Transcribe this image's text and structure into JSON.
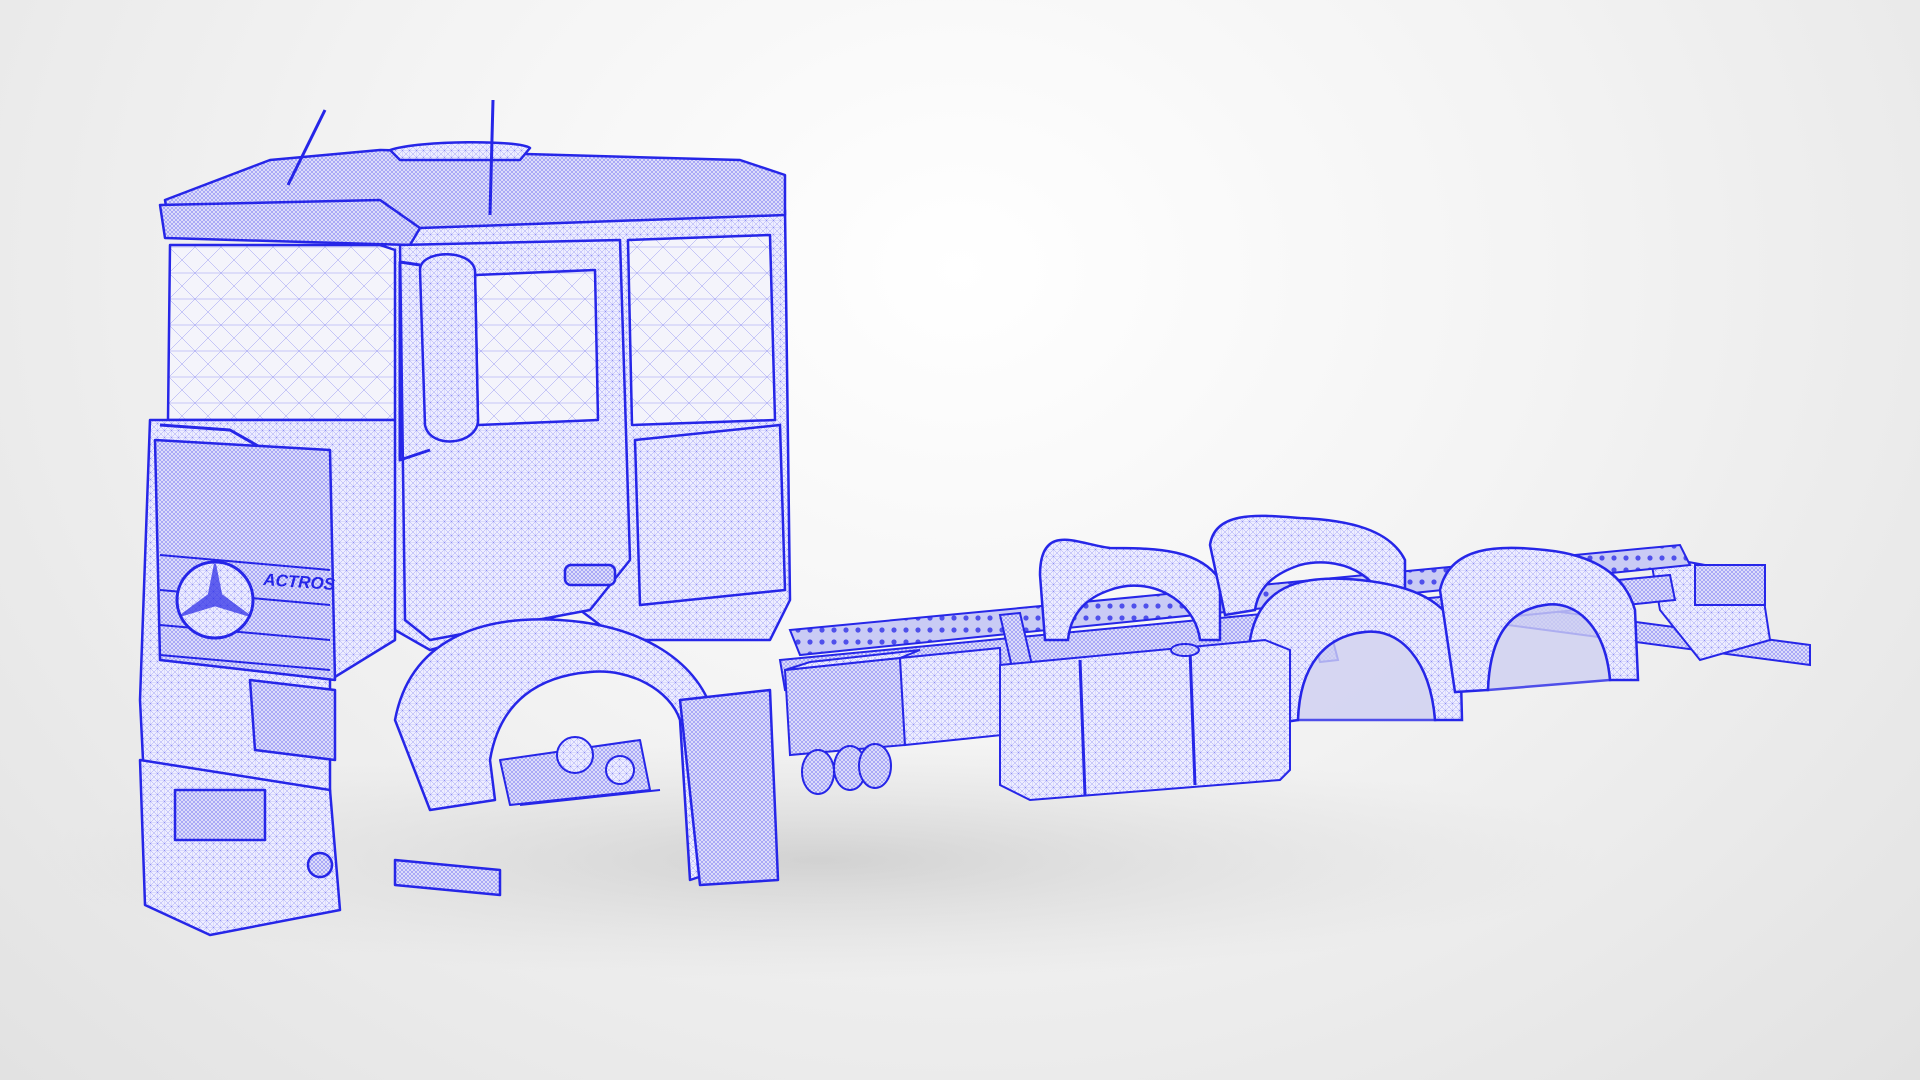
{
  "scene": {
    "subject": "truck-chassis-wireframe",
    "badge_text": "ACTROS"
  },
  "colors": {
    "wire": "#2626e8",
    "wire_light": "#8a8cf2",
    "fill": "#eeeeff",
    "fill_shade": "#d6d7f6",
    "background": "#e9e9e9"
  }
}
